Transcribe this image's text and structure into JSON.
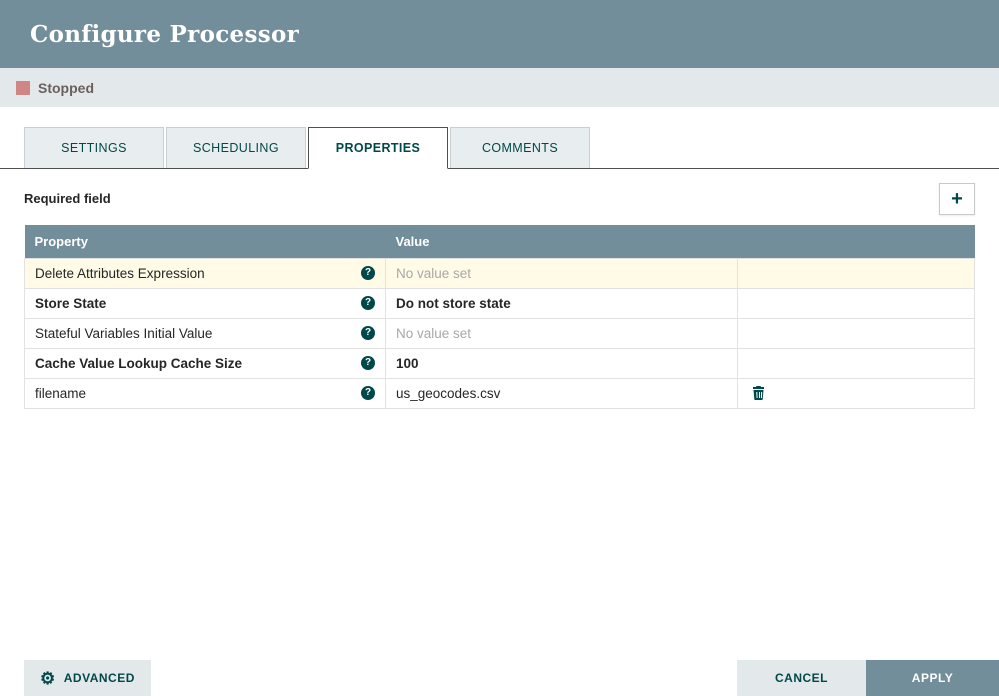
{
  "dialog": {
    "title": "Configure Processor",
    "status_label": "Stopped"
  },
  "tabs": [
    {
      "label": "SETTINGS",
      "active": false
    },
    {
      "label": "SCHEDULING",
      "active": false
    },
    {
      "label": "PROPERTIES",
      "active": true
    },
    {
      "label": "COMMENTS",
      "active": false
    }
  ],
  "properties_panel": {
    "required_field_label": "Required field",
    "add_icon": "+",
    "table": {
      "columns": [
        "Property",
        "Value"
      ],
      "rows": [
        {
          "property": "Delete Attributes Expression",
          "value": "No value set",
          "value_state": "empty",
          "required": false,
          "highlighted": true,
          "deletable": false
        },
        {
          "property": "Store State",
          "value": "Do not store state",
          "value_state": "set",
          "required": true,
          "highlighted": false,
          "deletable": false
        },
        {
          "property": "Stateful Variables Initial Value",
          "value": "No value set",
          "value_state": "empty",
          "required": false,
          "highlighted": false,
          "deletable": false
        },
        {
          "property": "Cache Value Lookup Cache Size",
          "value": "100",
          "value_state": "set",
          "required": true,
          "highlighted": false,
          "deletable": false
        },
        {
          "property": "filename",
          "value": "us_geocodes.csv",
          "value_state": "set",
          "required": false,
          "highlighted": false,
          "deletable": true
        }
      ]
    }
  },
  "footer": {
    "advanced_label": "ADVANCED",
    "gear_icon": "⚙",
    "cancel_label": "CANCEL",
    "apply_label": "APPLY"
  },
  "colors": {
    "header_bg": "#728e9b",
    "status_bg": "#e3e8eb",
    "stopped_icon": "#d18686",
    "accent": "#004849",
    "highlight_row": "#fffbe6"
  }
}
